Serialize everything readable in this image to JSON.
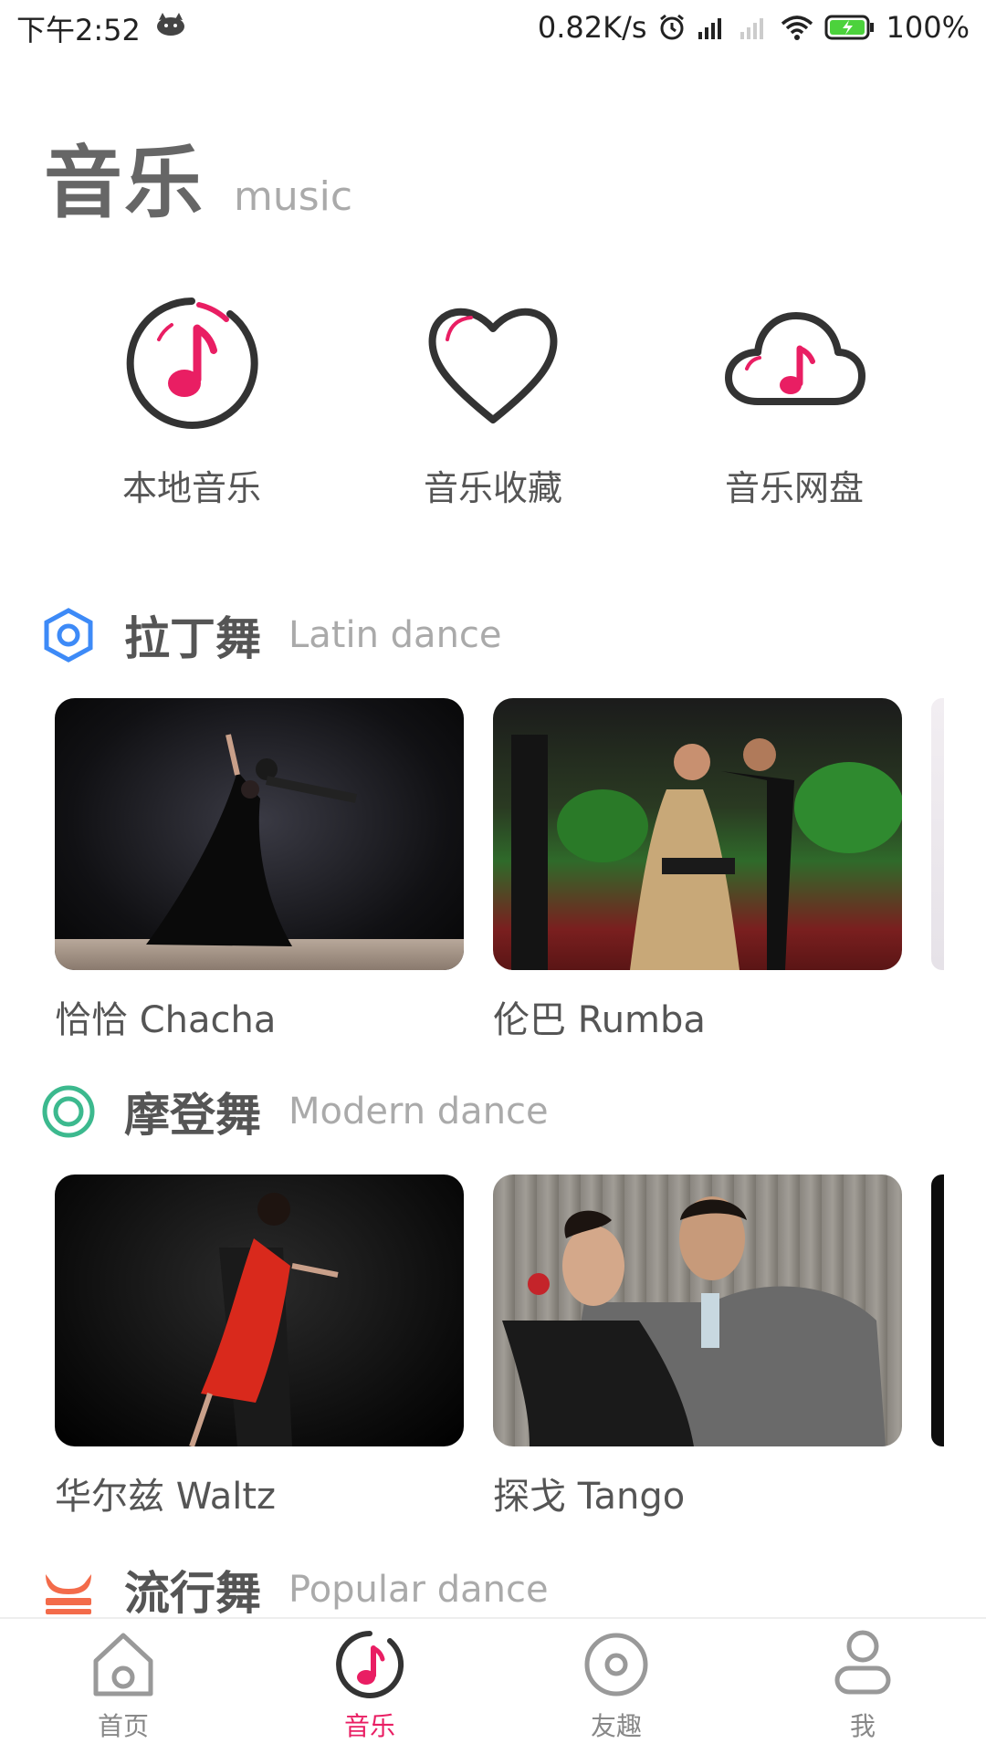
{
  "status_bar": {
    "time": "下午2:52",
    "network_speed": "0.82K/s",
    "battery": "100%"
  },
  "header": {
    "title": "音乐",
    "subtitle": "music"
  },
  "shortcuts": [
    {
      "label": "本地音乐",
      "icon": "music-note-circle-icon"
    },
    {
      "label": "音乐收藏",
      "icon": "heart-icon"
    },
    {
      "label": "音乐网盘",
      "icon": "cloud-music-icon"
    }
  ],
  "sections": [
    {
      "title": "拉丁舞",
      "subtitle": "Latin dance",
      "icon": "hexagon-icon",
      "icon_color": "#3d8af7",
      "cards": [
        {
          "caption": "恰恰 Chacha"
        },
        {
          "caption": "伦巴 Rumba"
        }
      ]
    },
    {
      "title": "摩登舞",
      "subtitle": "Modern dance",
      "icon": "ring-icon",
      "icon_color": "#3cb98e",
      "cards": [
        {
          "caption": "华尔兹 Waltz"
        },
        {
          "caption": "探戈 Tango"
        }
      ]
    },
    {
      "title": "流行舞",
      "subtitle": "Popular dance",
      "icon": "horned-helmet-icon",
      "icon_color": "#f36b4a"
    }
  ],
  "bottom_nav": [
    {
      "label": "首页",
      "icon": "home-icon",
      "active": false
    },
    {
      "label": "音乐",
      "icon": "music-note-circle-icon",
      "active": true
    },
    {
      "label": "友趣",
      "icon": "disc-icon",
      "active": false
    },
    {
      "label": "我",
      "icon": "person-icon",
      "active": false
    }
  ],
  "colors": {
    "accent": "#e91e63",
    "text_gray": "#555555",
    "subtitle_gray": "#aaaaaa"
  }
}
